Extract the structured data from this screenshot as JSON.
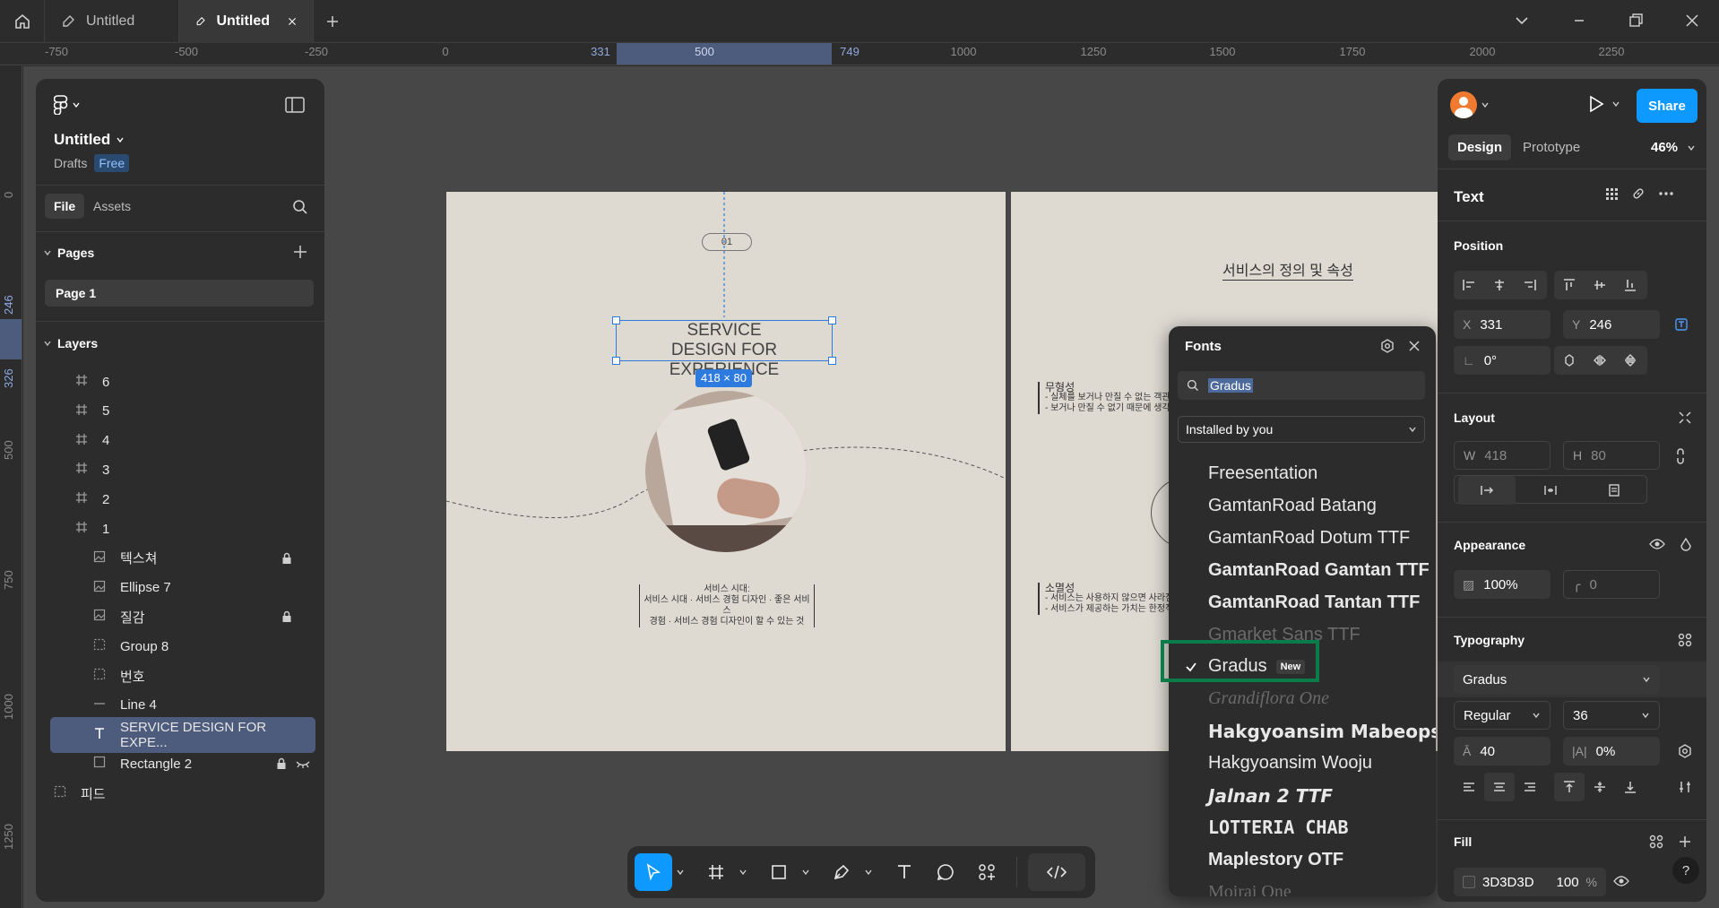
{
  "tabs": [
    {
      "title": "Untitled"
    },
    {
      "title": "Untitled",
      "active": true
    }
  ],
  "ruler_top": [
    "-750",
    "-500",
    "-250",
    "0",
    "331",
    "500",
    "749",
    "1000",
    "1250",
    "1500",
    "1750",
    "2000",
    "2250"
  ],
  "ruler_left": [
    "0",
    "246",
    "326",
    "500",
    "750",
    "1000",
    "1250"
  ],
  "file": {
    "name": "Untitled",
    "location": "Drafts",
    "plan": "Free"
  },
  "left_tabs": {
    "file": "File",
    "assets": "Assets"
  },
  "pages": {
    "title": "Pages",
    "items": [
      "Page 1"
    ]
  },
  "layers": {
    "title": "Layers",
    "items": [
      {
        "name": "6",
        "icon": "#"
      },
      {
        "name": "5",
        "icon": "#"
      },
      {
        "name": "4",
        "icon": "#"
      },
      {
        "name": "3",
        "icon": "#"
      },
      {
        "name": "2",
        "icon": "#"
      },
      {
        "name": "1",
        "icon": "#"
      },
      {
        "name": "텍스쳐",
        "icon": "img",
        "locked": true
      },
      {
        "name": "Ellipse 7",
        "icon": "img"
      },
      {
        "name": "질감",
        "icon": "img",
        "locked": true
      },
      {
        "name": "Group 8",
        "icon": "grp"
      },
      {
        "name": "번호",
        "icon": "grp"
      },
      {
        "name": "Line 4",
        "icon": "line"
      },
      {
        "name": "SERVICE DESIGN FOR EXPE...",
        "icon": "T",
        "selected": true
      },
      {
        "name": "Rectangle 2",
        "icon": "rect",
        "locked": true,
        "hidden": true
      },
      {
        "name": "피드",
        "icon": "grp"
      }
    ]
  },
  "canvas": {
    "frame1": {
      "badge": "01",
      "title_line1": "SERVICE",
      "title_line2": "DESIGN FOR EXPERIENCE",
      "size_label": "418 × 80",
      "caption_line1": "서비스 시대:",
      "caption_line2": "서비스 시대 · 서비스 경험 디자인 · 좋은 서비스",
      "caption_line3": "경험 · 서비스 경험 디자인이 할 수 있는 것"
    },
    "frame2": {
      "heading": "서비스의 정의 및 속성",
      "item1_title": "무형성",
      "item1_l1": "- 실체를 보거나 만질 수 없는 객관적인",
      "item1_l2": "- 보거나 만질 수 없기 때문에 생각이 다른",
      "item2_title": "소멸성",
      "item2_l1": "- 서비스는 사용하지 않으면 사라짐",
      "item2_l2": "- 서비스가 제공하는 가치는 한정적"
    }
  },
  "fonts_popup": {
    "title": "Fonts",
    "search_value": "Gradus",
    "filter": "Installed by you",
    "new_badge": "New",
    "items": [
      {
        "name": "Freesentation"
      },
      {
        "name": "GamtanRoad Batang"
      },
      {
        "name": "GamtanRoad Dotum TTF"
      },
      {
        "name": "GamtanRoad Gamtan TTF"
      },
      {
        "name": "GamtanRoad Tantan TTF"
      },
      {
        "name": "Gmarket Sans TTF"
      },
      {
        "name": "Gradus",
        "selected": true
      },
      {
        "name": "Grandiflora One"
      },
      {
        "name": "Hakgyoansim Mabeopsa"
      },
      {
        "name": "Hakgyoansim Wooju"
      },
      {
        "name": "Jalnan 2 TTF"
      },
      {
        "name": "LOTTERIA CHAB"
      },
      {
        "name": "Maplestory OTF"
      },
      {
        "name": "Moirai One"
      }
    ]
  },
  "right": {
    "share": "Share",
    "tab_design": "Design",
    "tab_prototype": "Prototype",
    "zoom": "46%",
    "layer_type": "Text",
    "position": {
      "title": "Position",
      "x_label": "X",
      "x": "331",
      "y_label": "Y",
      "y": "246",
      "rotation": "0°"
    },
    "layout": {
      "title": "Layout",
      "w_label": "W",
      "w": "418",
      "h_label": "H",
      "h": "80"
    },
    "appearance": {
      "title": "Appearance",
      "opacity": "100%",
      "radius": "0"
    },
    "typography": {
      "title": "Typography",
      "font": "Gradus",
      "weight": "Regular",
      "size": "36",
      "line_height": "40",
      "letter_spacing": "0%"
    },
    "fill": {
      "title": "Fill",
      "hex": "3D3D3D",
      "opacity": "100",
      "percent": "%"
    }
  },
  "colors": {
    "accent": "#0d99ff",
    "selection": "#4d5b7c",
    "highlight": "#0a7c4a"
  }
}
